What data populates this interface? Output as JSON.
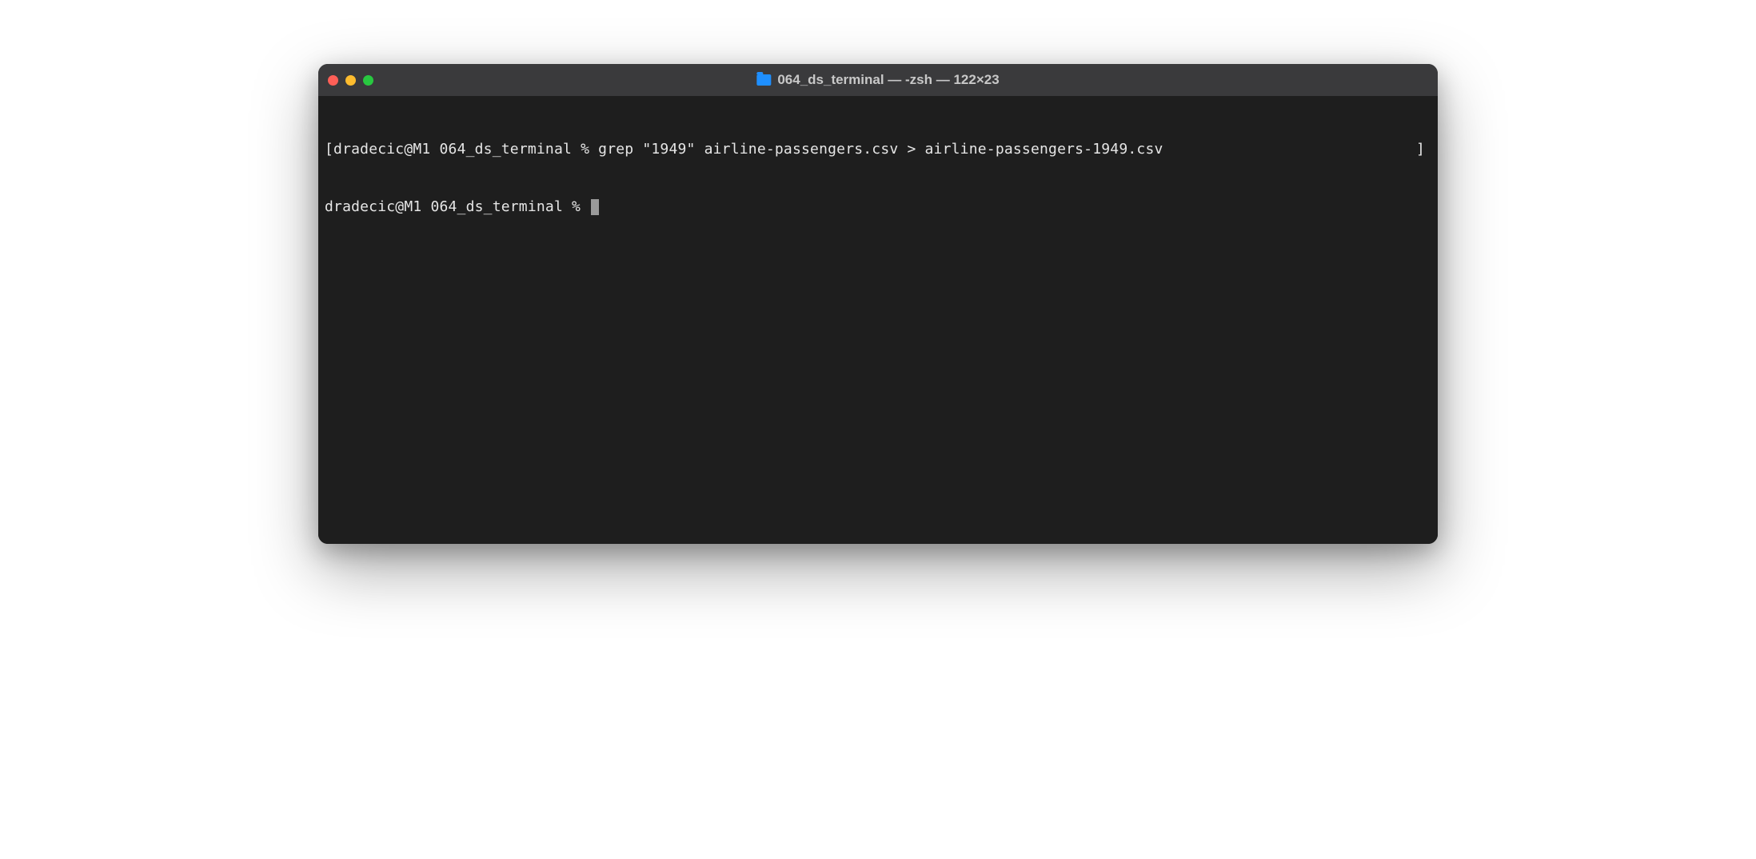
{
  "window": {
    "title": "064_ds_terminal — -zsh — 122×23"
  },
  "terminal": {
    "lines": [
      {
        "left_bracket": "[",
        "prompt": "dradecic@M1 064_ds_terminal % ",
        "command": "grep \"1949\" airline-passengers.csv > airline-passengers-1949.csv",
        "right_bracket": "]"
      },
      {
        "left_bracket": "",
        "prompt": "dradecic@M1 064_ds_terminal % ",
        "command": "",
        "right_bracket": ""
      }
    ]
  },
  "colors": {
    "window_bg": "#1e1e1e",
    "titlebar_bg": "#3a3a3c",
    "text": "#e6e6e6",
    "close": "#ff5f57",
    "minimize": "#febc2e",
    "zoom": "#28c840",
    "folder": "#1e8fff"
  }
}
